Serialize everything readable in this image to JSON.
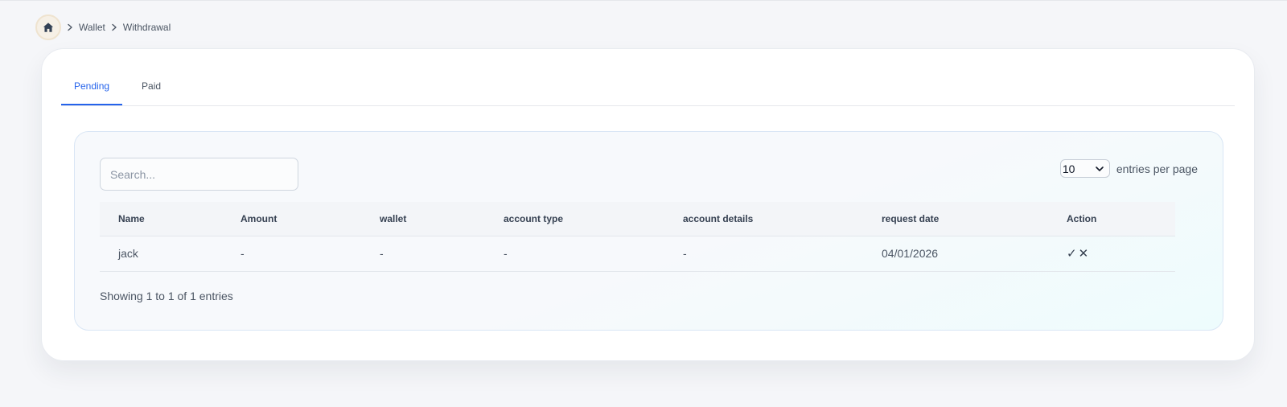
{
  "breadcrumb": {
    "home_icon": "home-icon",
    "items": [
      "Wallet",
      "Withdrawal"
    ]
  },
  "tabs": [
    {
      "label": "Pending",
      "active": true
    },
    {
      "label": "Paid",
      "active": false
    }
  ],
  "search": {
    "placeholder": "Search...",
    "value": ""
  },
  "pagination": {
    "per_page_value": "10",
    "per_page_label": "entries per page"
  },
  "table": {
    "columns": [
      "Name",
      "Amount",
      "wallet",
      "account type",
      "account details",
      "request date",
      "Action"
    ],
    "rows": [
      {
        "name": "jack",
        "amount": "-",
        "wallet": "-",
        "account_type": "-",
        "account_details": "-",
        "request_date": "04/01/2026",
        "approve": "✓",
        "reject": "✕"
      }
    ]
  },
  "footer": {
    "showing": "Showing 1 to 1 of 1 entries"
  },
  "colors": {
    "accent": "#2563eb",
    "home_bg": "#f6f0e6"
  }
}
